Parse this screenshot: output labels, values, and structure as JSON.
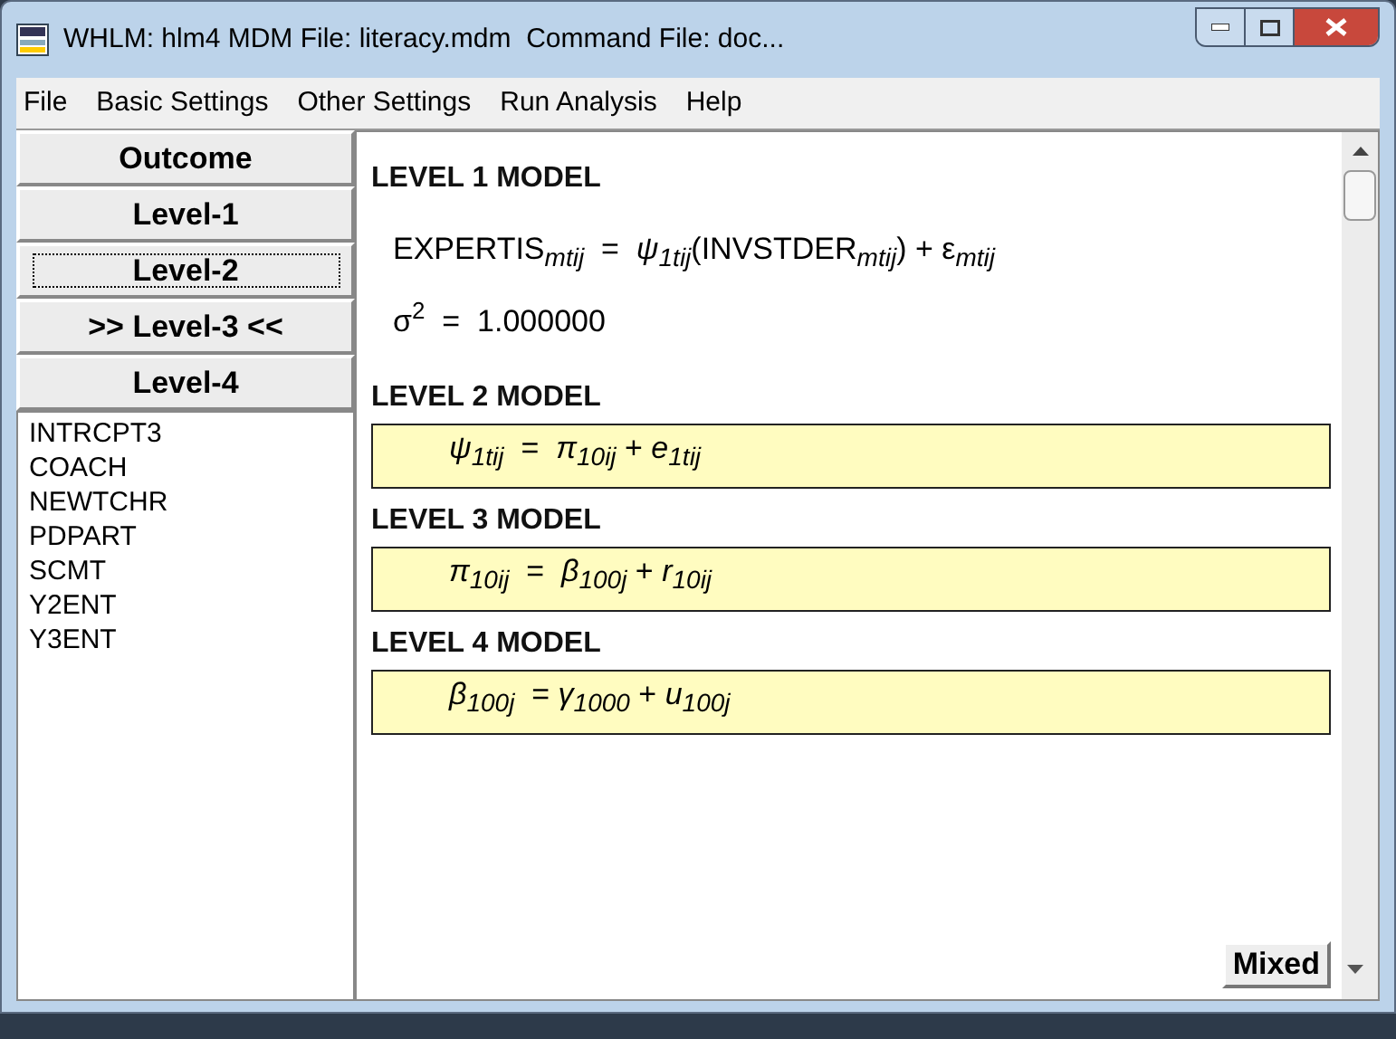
{
  "window": {
    "title": "WHLM: hlm4 MDM File: literacy.mdm  Command File: doc..."
  },
  "menu": [
    "File",
    "Basic Settings",
    "Other Settings",
    "Run Analysis",
    "Help"
  ],
  "level_buttons": [
    {
      "label": "Outcome",
      "focused": false
    },
    {
      "label": "Level-1",
      "focused": false
    },
    {
      "label": "Level-2",
      "focused": true
    },
    {
      "label": ">> Level-3 <<",
      "focused": false
    },
    {
      "label": "Level-4",
      "focused": false
    }
  ],
  "variables": [
    "INTRCPT3",
    "COACH",
    "NEWTCHR",
    "PDPART",
    "SCMT",
    "Y2ENT",
    "Y3ENT"
  ],
  "models": [
    {
      "heading": "LEVEL 1 MODEL",
      "kind": "plain",
      "equations": [
        "EXPERTIS$_{mtij}$  =  *ψ*$_{1tij}$(INVSTDER$_{mtij}$) + ε$_{mtij}$",
        "σ$^{2}$  =  1.000000"
      ]
    },
    {
      "heading": "LEVEL 2 MODEL",
      "kind": "boxed",
      "equations": [
        "*ψ*$_{1tij}$  =  *π*$_{10ij}$ + *e*$_{1tij}$"
      ]
    },
    {
      "heading": "LEVEL 3 MODEL",
      "kind": "boxed",
      "equations": [
        "*π*$_{10ij}$  =  *β*$_{100j}$ + *r*$_{10ij}$"
      ]
    },
    {
      "heading": "LEVEL 4 MODEL",
      "kind": "boxed",
      "equations": [
        "*β*$_{100j}$  = *γ*$_{1000}$ + *u*$_{100j}$"
      ]
    }
  ],
  "mixed_button": "Mixed"
}
